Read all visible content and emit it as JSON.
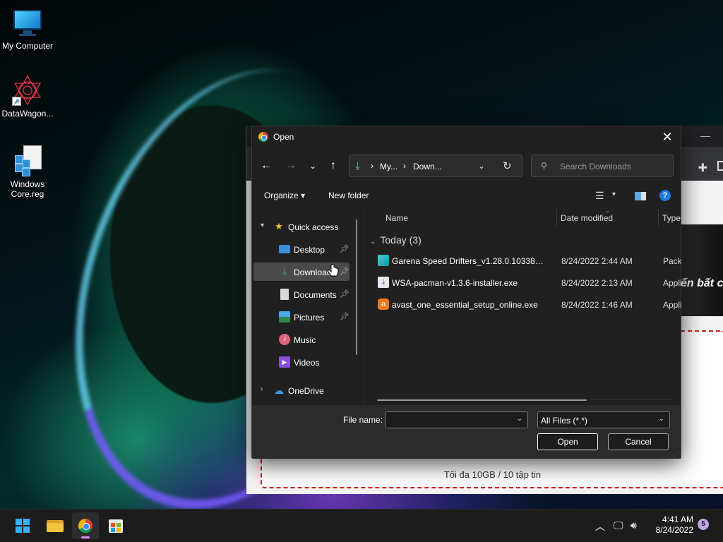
{
  "desktop": {
    "icons": [
      {
        "label": "My Computer",
        "icon": "my-computer-icon"
      },
      {
        "label": "DataWagon...",
        "icon": "datawagon-shortcut-icon"
      },
      {
        "label": "Windows Core.reg",
        "icon": "registry-file-icon"
      }
    ]
  },
  "browser": {
    "photo_text": "ến bất c",
    "upload_limit": "Tối đa 10GB / 10 tập tin"
  },
  "dialog": {
    "title": "Open",
    "nav": {
      "back": "←",
      "forward": "→",
      "recent": "⌄",
      "up": "↑"
    },
    "address": {
      "crumbs": [
        "My...",
        "Down..."
      ],
      "separator": "›"
    },
    "search": {
      "placeholder": "Search Downloads"
    },
    "toolbar": {
      "organize": "Organize",
      "new_folder": "New folder",
      "help": "?"
    },
    "nav_pane": {
      "quick_access": "Quick access",
      "items": [
        {
          "label": "Desktop",
          "icon": "desktop-folder-icon",
          "pinned": true
        },
        {
          "label": "Downloads",
          "icon": "downloads-folder-icon",
          "pinned": true,
          "selected": true
        },
        {
          "label": "Documents",
          "icon": "documents-folder-icon",
          "pinned": true
        },
        {
          "label": "Pictures",
          "icon": "pictures-folder-icon",
          "pinned": true
        },
        {
          "label": "Music",
          "icon": "music-folder-icon",
          "pinned": false
        },
        {
          "label": "Videos",
          "icon": "videos-folder-icon",
          "pinned": false
        }
      ],
      "onedrive": "OneDrive"
    },
    "columns": {
      "name": "Name",
      "date": "Date modified",
      "type": "Type"
    },
    "group": "Today (3)",
    "files": [
      {
        "name": "Garena Speed Drifters_v1.28.0.10338_apk...",
        "date": "8/24/2022 2:44 AM",
        "type": "Packa",
        "icon": "package-file-icon"
      },
      {
        "name": "WSA-pacman-v1.3.6-installer.exe",
        "date": "8/24/2022 2:13 AM",
        "type": "Appli",
        "icon": "installer-file-icon"
      },
      {
        "name": "avast_one_essential_setup_online.exe",
        "date": "8/24/2022 1:46 AM",
        "type": "Appli",
        "icon": "avast-app-icon"
      }
    ],
    "file_name_label": "File name:",
    "file_name_value": "",
    "file_type": "All Files (*.*)",
    "open_button": "Open",
    "cancel_button": "Cancel"
  },
  "taskbar": {
    "apps": [
      "start-icon",
      "file-explorer-icon",
      "chrome-icon",
      "microsoft-store-icon"
    ],
    "time": "4:41 AM",
    "date": "8/24/2022",
    "notification_count": "5"
  },
  "colors": {
    "accent": "#1e7be0",
    "selection": "#4a4a4a",
    "dialog_bg": "#202020",
    "dropzone_border": "#d02020"
  }
}
